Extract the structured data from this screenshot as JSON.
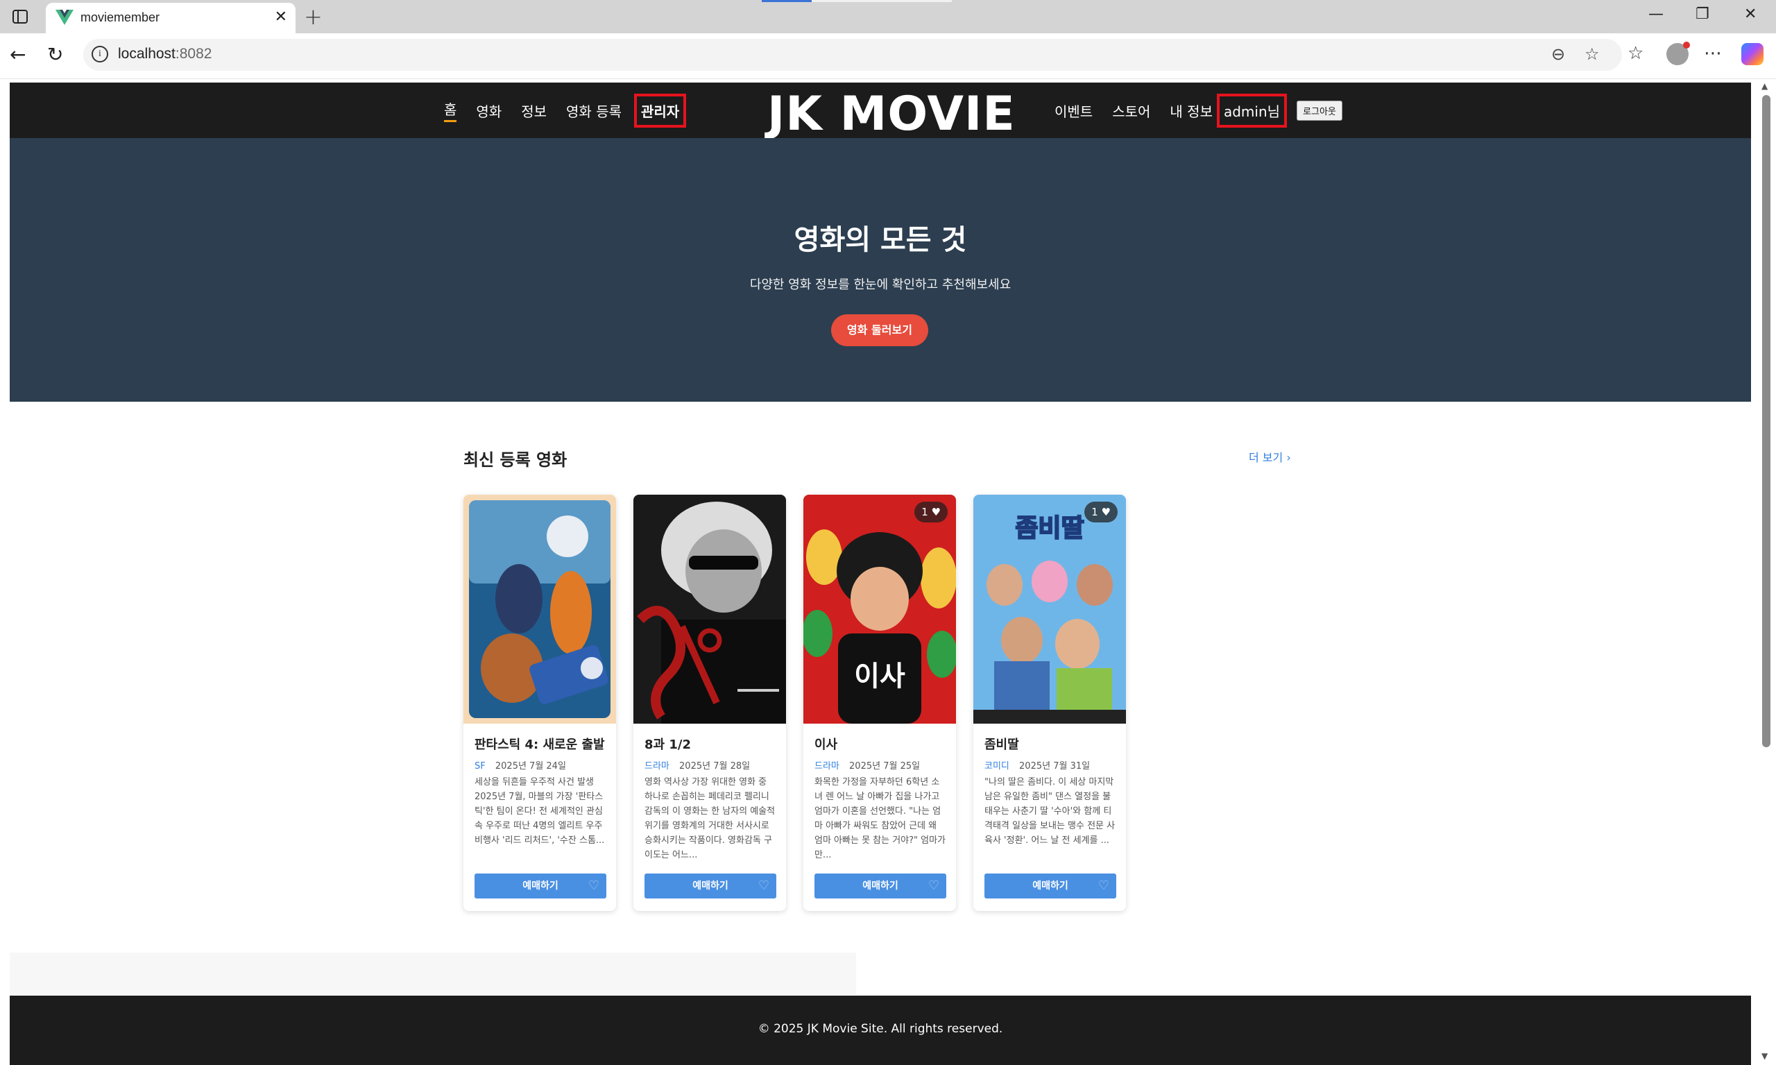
{
  "browser": {
    "tab_title": "moviemember",
    "url_host": "localhost",
    "url_port": ":8082"
  },
  "site": {
    "logo": "JK MOVIE",
    "nav_left": [
      "홈",
      "영화",
      "정보",
      "영화 등록",
      "관리자"
    ],
    "nav_right": [
      "이벤트",
      "스토어",
      "내 정보"
    ],
    "user_label": "admin님",
    "logout_label": "로그아웃",
    "accent_color": "#e5131d"
  },
  "hero": {
    "title": "영화의 모든 것",
    "subtitle": "다양한 영화 정보를 한눈에 확인하고 추천해보세요",
    "button": "영화 둘러보기"
  },
  "latest": {
    "title": "최신 등록 영화",
    "more": "더 보기 ›",
    "movies": [
      {
        "title": "판타스틱 4: 새로운 출발",
        "genre": "SF",
        "date": "2025년 7월 24일",
        "description": "세상을 뒤흔들 우주적 사건 발생 2025년 7월, 마블의 가장 '판타스틱'한 팀이 온다! 전 세계적인 관심 속 우주로 떠난 4명의 엘리트 우주비행사 '리드 리처드', '수잔 스톰...",
        "likes": "",
        "book": "예매하기",
        "heart": "♡"
      },
      {
        "title": "8과 1/2",
        "genre": "드라마",
        "date": "2025년 7월 28일",
        "description": "영화 역사상 가장 위대한 영화 중 하나로 손꼽히는 페데리코 펠리니 감독의 이 영화는 한 남자의 예술적 위기를 영화계의 거대한 서사시로 승화시키는 작품이다. 영화감독 구이도는 어느...",
        "likes": "",
        "book": "예매하기",
        "heart": "♡"
      },
      {
        "title": "이사",
        "genre": "드라마",
        "date": "2025년 7월 25일",
        "description": "화목한 가정을 자부하던 6학년 소녀 렌 어느 날 아빠가 집을 나가고 엄마가 이혼을 선언했다. \"나는 엄마 아빠가 싸워도 참았어 근데 왜 엄마 아빠는 못 참는 거야?\" 엄마가 만...",
        "likes": "1 ♥",
        "book": "예매하기",
        "heart": "♡"
      },
      {
        "title": "좀비딸",
        "genre": "코미디",
        "date": "2025년 7월 31일",
        "description": "\"나의 딸은 좀비다. 이 세상 마지막 남은 유일한 좀비\" 댄스 열정을 불태우는 사춘기 딸 '수아'와 함께 티격태격 일상을 보내는 맹수 전문 사육사 '정환'. 어느 날 전 세계를 ...",
        "likes": "1 ♥",
        "book": "예매하기",
        "heart": "♡"
      }
    ]
  },
  "footer": {
    "text": "© 2025 JK Movie Site. All rights reserved."
  }
}
